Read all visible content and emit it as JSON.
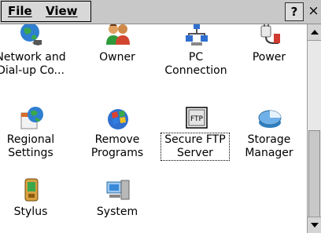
{
  "menu": {
    "file": "File",
    "view": "View"
  },
  "titlebar": {
    "help": "?",
    "close": "×"
  },
  "items": [
    {
      "label": "Network and\nDial-up Co...",
      "icon": "network-globe-icon"
    },
    {
      "label": "Owner",
      "icon": "owner-people-icon"
    },
    {
      "label": "PC\nConnection",
      "icon": "pc-connection-icon"
    },
    {
      "label": "Power",
      "icon": "power-plug-icon"
    },
    {
      "label": "Regional\nSettings",
      "icon": "regional-settings-icon"
    },
    {
      "label": "Remove\nPrograms",
      "icon": "remove-programs-icon"
    },
    {
      "label": "Secure FTP\nServer",
      "icon": "ftp-icon",
      "selected": true,
      "icon_text": "FTP"
    },
    {
      "label": "Storage\nManager",
      "icon": "storage-manager-icon"
    },
    {
      "label": "Stylus",
      "icon": "stylus-device-icon"
    },
    {
      "label": "System",
      "icon": "system-computer-icon"
    }
  ]
}
